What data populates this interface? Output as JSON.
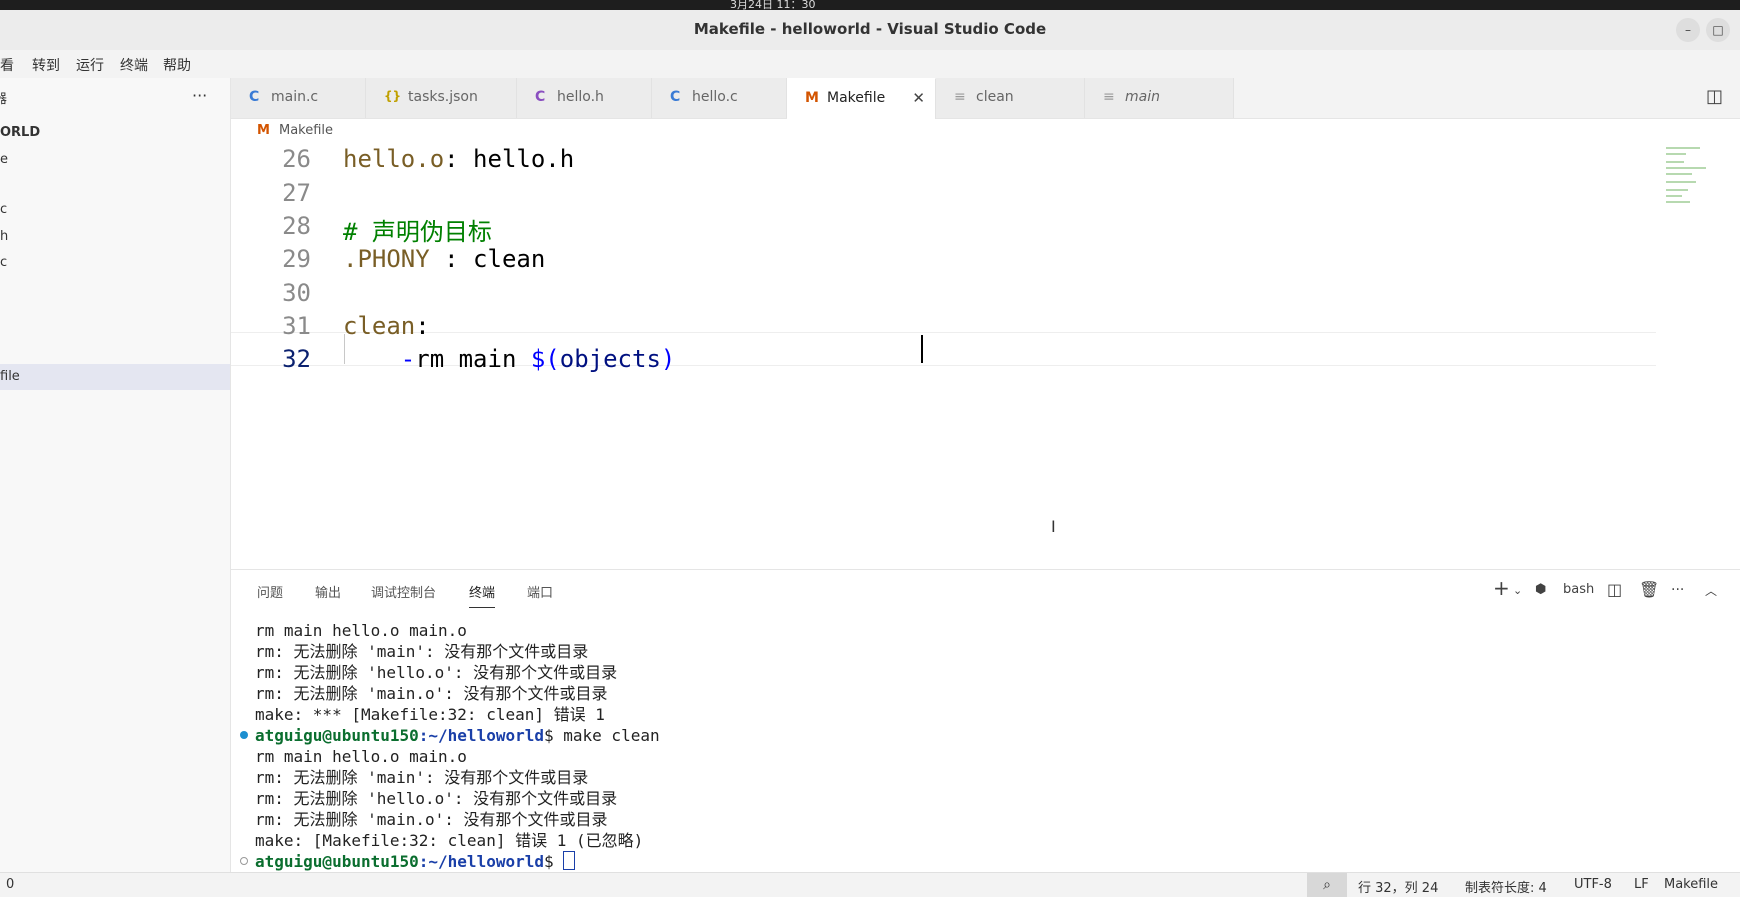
{
  "window": {
    "title": "Makefile - helloworld - Visual Studio Code",
    "clock_fragment": "3月24日 11：30",
    "buttons": {
      "minimize": "–",
      "maximize": "□",
      "close": "✕"
    }
  },
  "menubar": {
    "items": [
      "查看",
      "转到",
      "运行",
      "终端",
      "帮助"
    ],
    "first_partial": "查看"
  },
  "sidebar": {
    "header_partial": "器",
    "more": "···",
    "project_partial": "ORLD",
    "rows": [
      "e",
      "",
      "c",
      "h",
      "c",
      "",
      "",
      "",
      "file"
    ]
  },
  "tabs": [
    {
      "icon": "C",
      "label": "main.c",
      "icon_color": "#3a7bd5"
    },
    {
      "icon": "{}",
      "label": "tasks.json",
      "icon_color": "#c0a000"
    },
    {
      "icon": "C",
      "label": "hello.h",
      "icon_color": "#8a4fc0"
    },
    {
      "icon": "C",
      "label": "hello.c",
      "icon_color": "#3a7bd5"
    },
    {
      "icon": "M",
      "label": "Makefile",
      "icon_color": "#d35400",
      "active": true,
      "close": "✕"
    },
    {
      "icon": "≡",
      "label": "clean",
      "icon_color": "#9a9a9a"
    },
    {
      "icon": "≡",
      "label": "main",
      "icon_color": "#9a9a9a"
    }
  ],
  "breadcrumb": {
    "icon": "M",
    "label": "Makefile"
  },
  "editor": {
    "lines": [
      {
        "n": "26",
        "parts": [
          {
            "t": "hello.o",
            "c": "c-target"
          },
          {
            "t": ": hello.h",
            "c": ""
          }
        ]
      },
      {
        "n": "27",
        "parts": []
      },
      {
        "n": "28",
        "parts": [
          {
            "t": "# 声明伪目标",
            "c": "c-comment"
          }
        ]
      },
      {
        "n": "29",
        "parts": [
          {
            "t": ".PHONY",
            "c": "c-target"
          },
          {
            "t": " : clean",
            "c": ""
          }
        ]
      },
      {
        "n": "30",
        "parts": []
      },
      {
        "n": "31",
        "parts": [
          {
            "t": "clean",
            "c": "c-target"
          },
          {
            "t": ":",
            "c": ""
          }
        ]
      },
      {
        "n": "32",
        "current": true,
        "parts": [
          {
            "t": "    -",
            "c": "c-blue"
          },
          {
            "t": "rm main ",
            "c": ""
          },
          {
            "t": "$(",
            "c": "c-blue"
          },
          {
            "t": "objects",
            "c": "c-var"
          },
          {
            "t": ")",
            "c": "c-blue"
          }
        ]
      }
    ]
  },
  "panel": {
    "tabs": [
      "问题",
      "输出",
      "调试控制台",
      "终端",
      "端口"
    ],
    "active_tab": "终端",
    "shell": "bash",
    "terminal_lines": [
      {
        "text": "rm main hello.o main.o"
      },
      {
        "text": "rm: 无法删除 'main': 没有那个文件或目录"
      },
      {
        "text": "rm: 无法删除 'hello.o': 没有那个文件或目录"
      },
      {
        "text": "rm: 无法删除 'main.o': 没有那个文件或目录"
      },
      {
        "text": "make: *** [Makefile:32: clean] 错误 1"
      },
      {
        "prompt": true,
        "dot": "filled",
        "user": "atguigu@ubuntu150",
        "path": ":~/helloworld",
        "cmd": "$ make clean"
      },
      {
        "text": "rm main hello.o main.o"
      },
      {
        "text": "rm: 无法删除 'main': 没有那个文件或目录"
      },
      {
        "text": "rm: 无法删除 'hello.o': 没有那个文件或目录"
      },
      {
        "text": "rm: 无法删除 'main.o': 没有那个文件或目录"
      },
      {
        "text": "make: [Makefile:32: clean] 错误 1 (已忽略)"
      },
      {
        "prompt": true,
        "dot": "hollow",
        "user": "atguigu@ubuntu150",
        "path": ":~/helloworld",
        "cmd": "$ ",
        "cursor": true
      }
    ]
  },
  "statusbar": {
    "left": "0",
    "position": "行 32，列 24",
    "tab_size": "制表符长度: 4",
    "encoding": "UTF-8",
    "eol": "LF",
    "language": "Makefile"
  }
}
